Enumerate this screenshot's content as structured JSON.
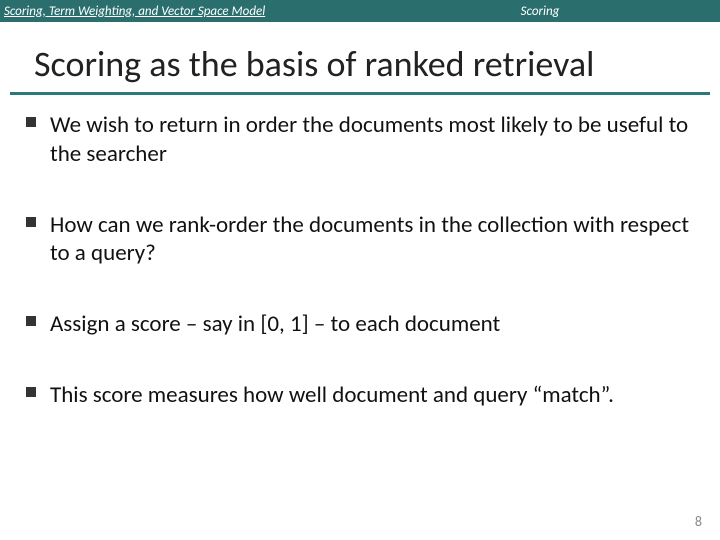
{
  "header": {
    "left": "Scoring, Term Weighting, and Vector Space Model",
    "right": "Scoring"
  },
  "title": "Scoring as the basis of ranked retrieval",
  "bullets": [
    "We wish to return in order the documents most likely to be useful to the searcher",
    "How can we rank-order the documents in the collection with respect to a query?",
    "Assign a score – say in [0, 1] – to each document",
    "This score measures how well document and query “match”."
  ],
  "pageNumber": "8"
}
